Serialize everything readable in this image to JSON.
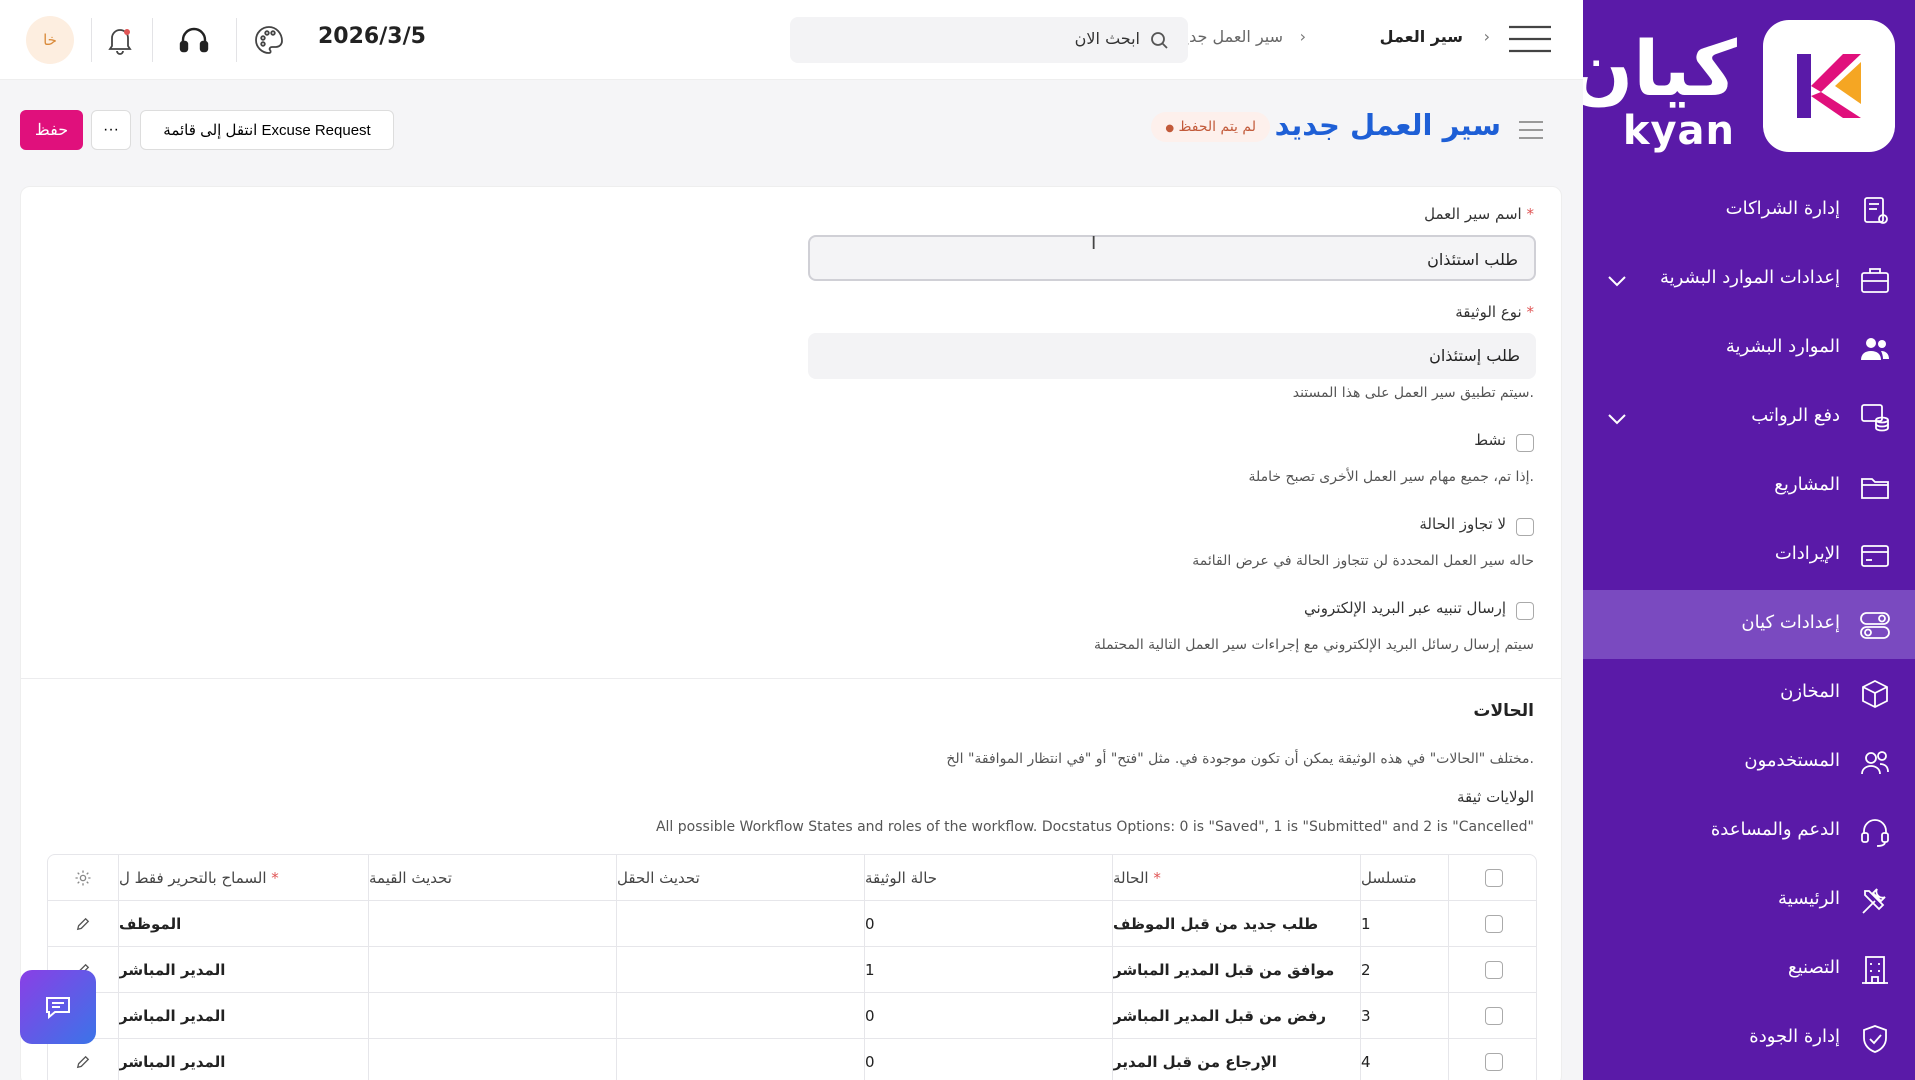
{
  "sidebar": {
    "logo_ar": "كيان",
    "logo_en": "kyan",
    "items": [
      {
        "label": "إدارة الشراكات"
      },
      {
        "label": "إعدادات الموارد البشرية"
      },
      {
        "label": "الموارد البشرية"
      },
      {
        "label": "دفع الرواتب"
      },
      {
        "label": "المشاريع"
      },
      {
        "label": "الإيرادات"
      },
      {
        "label": "إعدادات كيان"
      },
      {
        "label": "المخازن"
      },
      {
        "label": "المستخدمون"
      },
      {
        "label": "الدعم والمساعدة"
      },
      {
        "label": "الرئيسية"
      },
      {
        "label": "التصنيع"
      },
      {
        "label": "إدارة الجودة"
      }
    ]
  },
  "topbar": {
    "breadcrumb": [
      "سير العمل",
      "سير العمل جديد"
    ],
    "breadcrumb_sep": "›",
    "search_placeholder": "ابحث الان",
    "date": "2026/3/5",
    "avatar": "خا"
  },
  "header": {
    "title": "سير العمل جديد",
    "status": "لم يتم الحفظ",
    "goto_label": "انتقل إلى قائمة Excuse Request",
    "more_label": "···",
    "save_label": "حفظ"
  },
  "form": {
    "workflow_name_label": "اسم سير العمل",
    "workflow_name_value": "طلب استئذان",
    "doc_type_label": "نوع الوثيقة",
    "doc_type_value": "طلب إستئذان",
    "doc_type_help": "سيتم تطبيق سير العمل على هذا المستند.",
    "active_label": "نشط",
    "active_help": "إذا تم، جميع مهام سير العمل الأخرى تصبح خاملة.",
    "no_override_label": "لا تجاوز الحالة",
    "no_override_help": "حاله سير العمل المحددة لن تتجاوز الحالة في عرض القائمة",
    "email_alert_label": "إرسال تنبيه عبر البريد الإلكتروني",
    "email_alert_help": "سيتم إرسال رسائل البريد الإلكتروني مع إجراءات سير العمل التالية المحتملة",
    "required_mark": "*"
  },
  "states": {
    "title": "الحالات",
    "description": "مختلف \"الحالات\" في هذه الوثيقة يمكن أن تكون موجودة في. مثل \"فتح\" أو \"في انتظار الموافقة\" الخ.",
    "subtitle": "الولايات ثيقة",
    "docstatus_help": "All possible Workflow States and roles of the workflow. Docstatus Options: 0 is \"Saved\", 1 is \"Submitted\" and 2 is \"Cancelled\"",
    "columns": {
      "serial": "متسلسل",
      "state": "الحالة",
      "doc_status": "حالة الوثيقة",
      "update_field": "تحديث الحقل",
      "update_value": "تحديث القيمة",
      "allow_edit": "السماح بالتحرير فقط ل"
    },
    "rows": [
      {
        "serial": "1",
        "state": "طلب جديد من قبل الموظف",
        "doc_status": "0",
        "allow_edit": "الموظف"
      },
      {
        "serial": "2",
        "state": "موافق من قبل المدير المباشر",
        "doc_status": "1",
        "allow_edit": "المدير المباشر"
      },
      {
        "serial": "3",
        "state": "رفض من قبل المدير المباشر",
        "doc_status": "0",
        "allow_edit": "المدير المباشر"
      },
      {
        "serial": "4",
        "state": "الإرجاع من قبل المدير",
        "doc_status": "0",
        "allow_edit": "المدير المباشر"
      }
    ]
  },
  "colors": {
    "sidebar_bg": "#5a1aa8",
    "accent_pink": "#e0107c",
    "title_blue": "#1e5fd6"
  }
}
